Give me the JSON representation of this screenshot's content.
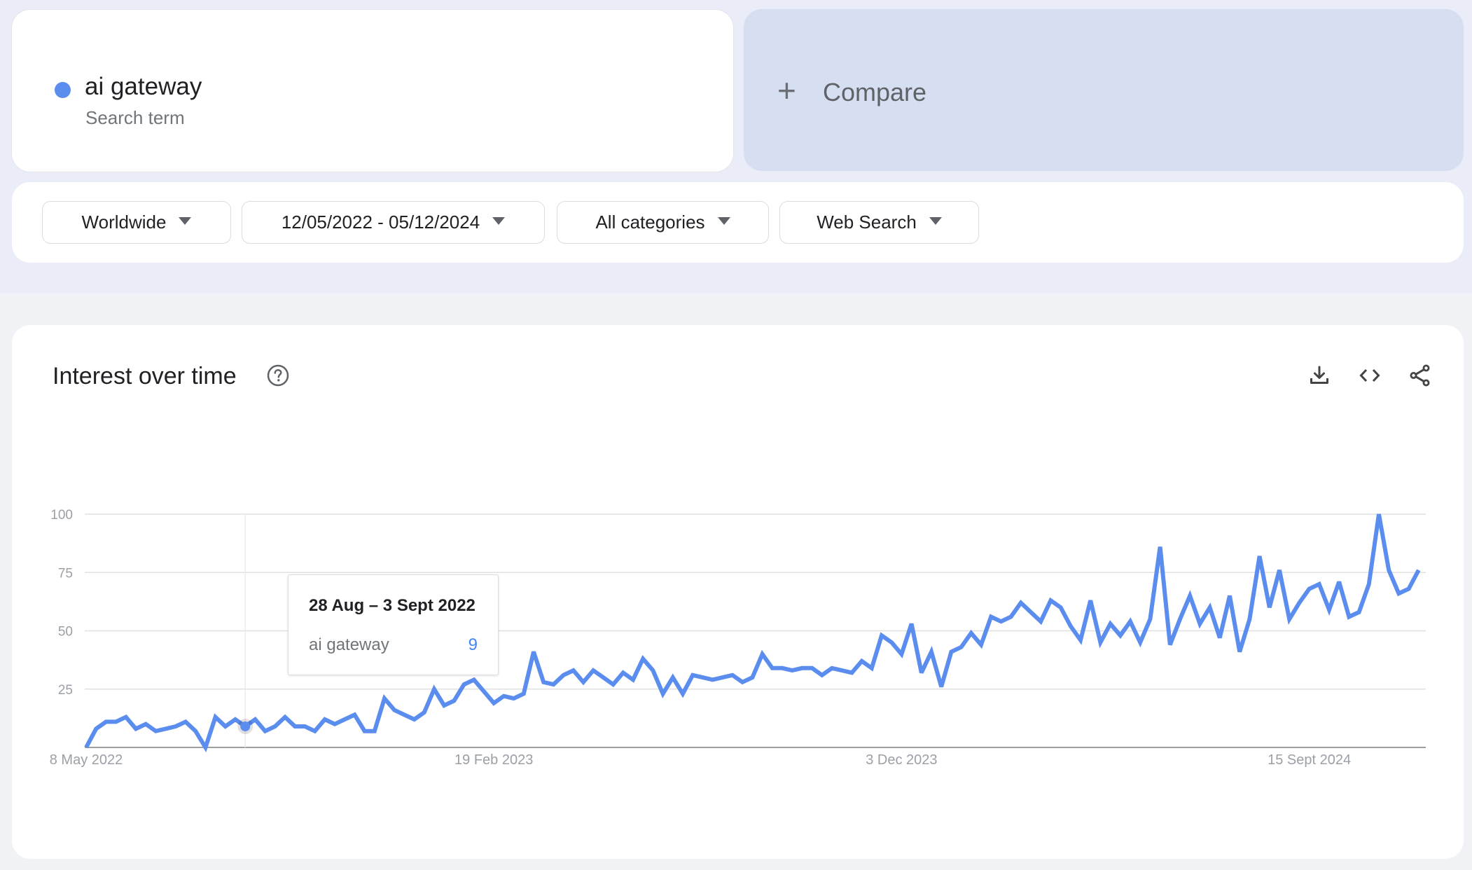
{
  "search_term": {
    "name": "ai gateway",
    "type_label": "Search term",
    "color": "#5b8def"
  },
  "compare": {
    "icon": "plus-icon",
    "label": "Compare"
  },
  "filters": {
    "region": "Worldwide",
    "date_range": "12/05/2022 - 05/12/2024",
    "category": "All categories",
    "property": "Web Search"
  },
  "chart_section": {
    "title": "Interest over time",
    "help_icon": "help-circle-icon",
    "actions": [
      "download-icon",
      "embed-code-icon",
      "share-icon"
    ]
  },
  "tooltip": {
    "date": "28 Aug – 3 Sept 2022",
    "series": "ai gateway",
    "value": "9",
    "point_index": 16
  },
  "chart_data": {
    "type": "line",
    "title": "Interest over time",
    "xlabel": "",
    "ylabel": "",
    "ylim": [
      0,
      100
    ],
    "yticks": [
      25,
      50,
      75,
      100
    ],
    "grid": true,
    "x_start": "8 May 2022",
    "x_interval": "weekly",
    "xtick_labels": [
      {
        "label": "8 May 2022",
        "index": 0
      },
      {
        "label": "19 Feb 2023",
        "index": 41
      },
      {
        "label": "3 Dec 2023",
        "index": 82
      },
      {
        "label": "15 Sept 2024",
        "index": 123
      }
    ],
    "series": [
      {
        "name": "ai gateway",
        "color": "#5b8def",
        "values": [
          0,
          8,
          11,
          11,
          13,
          8,
          10,
          7,
          8,
          9,
          11,
          7,
          0,
          13,
          9,
          12,
          9,
          12,
          7,
          9,
          13,
          9,
          9,
          7,
          12,
          10,
          12,
          14,
          7,
          7,
          21,
          16,
          14,
          12,
          15,
          25,
          18,
          20,
          27,
          29,
          24,
          19,
          22,
          21,
          23,
          41,
          28,
          27,
          31,
          33,
          28,
          33,
          30,
          27,
          32,
          29,
          38,
          33,
          23,
          30,
          23,
          31,
          30,
          29,
          30,
          31,
          28,
          30,
          40,
          34,
          34,
          33,
          34,
          34,
          31,
          34,
          33,
          32,
          37,
          34,
          48,
          45,
          40,
          53,
          32,
          41,
          26,
          41,
          43,
          49,
          44,
          56,
          54,
          56,
          62,
          58,
          54,
          63,
          60,
          52,
          46,
          63,
          45,
          53,
          48,
          54,
          45,
          55,
          86,
          44,
          55,
          65,
          53,
          60,
          47,
          65,
          41,
          55,
          82,
          60,
          76,
          55,
          62,
          68,
          70,
          59,
          71,
          56,
          58,
          70,
          100,
          76,
          66,
          68,
          76
        ]
      }
    ]
  }
}
